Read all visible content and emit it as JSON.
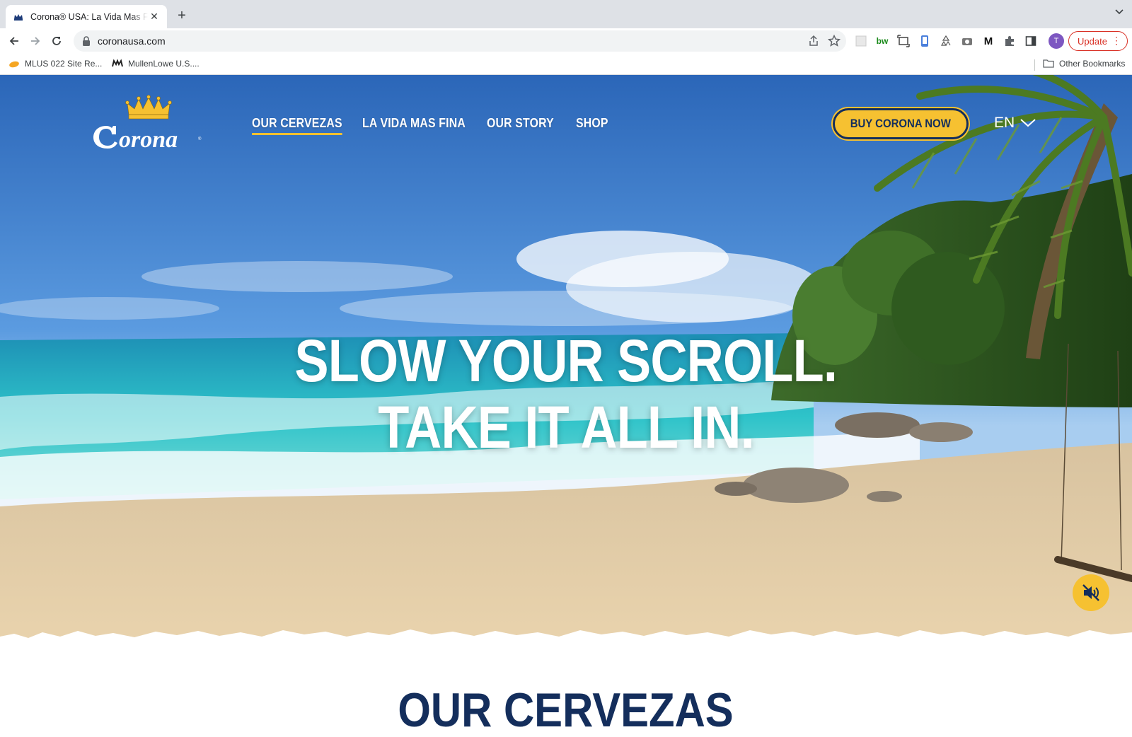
{
  "browser": {
    "tab": {
      "title": "Corona® USA: La Vida Mas Fina",
      "close_glyph": "✕"
    },
    "new_tab_glyph": "+",
    "address": {
      "url": "coronausa.com"
    },
    "update_label": "Update",
    "update_menu_glyph": "⋮",
    "profile_initial": "T",
    "bookmarks": [
      {
        "label": "MLUS 022 Site Re...",
        "icon": "orange-bookmark-icon"
      },
      {
        "label": "MullenLowe U.S....",
        "icon": "mullenlowe-icon"
      }
    ],
    "other_bookmarks_label": "Other Bookmarks",
    "extensions": [
      "bw",
      "M"
    ]
  },
  "site": {
    "nav": {
      "items": [
        {
          "label": "OUR CERVEZAS",
          "active": true
        },
        {
          "label": "LA VIDA MAS FINA",
          "active": false
        },
        {
          "label": "OUR STORY",
          "active": false
        },
        {
          "label": "SHOP",
          "active": false
        }
      ],
      "buy_label": "BUY CORONA NOW",
      "language": "EN"
    },
    "hero": {
      "headline_line1": "SLOW YOUR SCROLL.",
      "headline_line2": "TAKE IT ALL IN.",
      "mute_icon": "speaker-muted-icon"
    },
    "section_title": "OUR CERVEZAS"
  },
  "colors": {
    "accent_yellow": "#f6c131",
    "navy": "#142e5c",
    "update_red": "#d93025"
  }
}
